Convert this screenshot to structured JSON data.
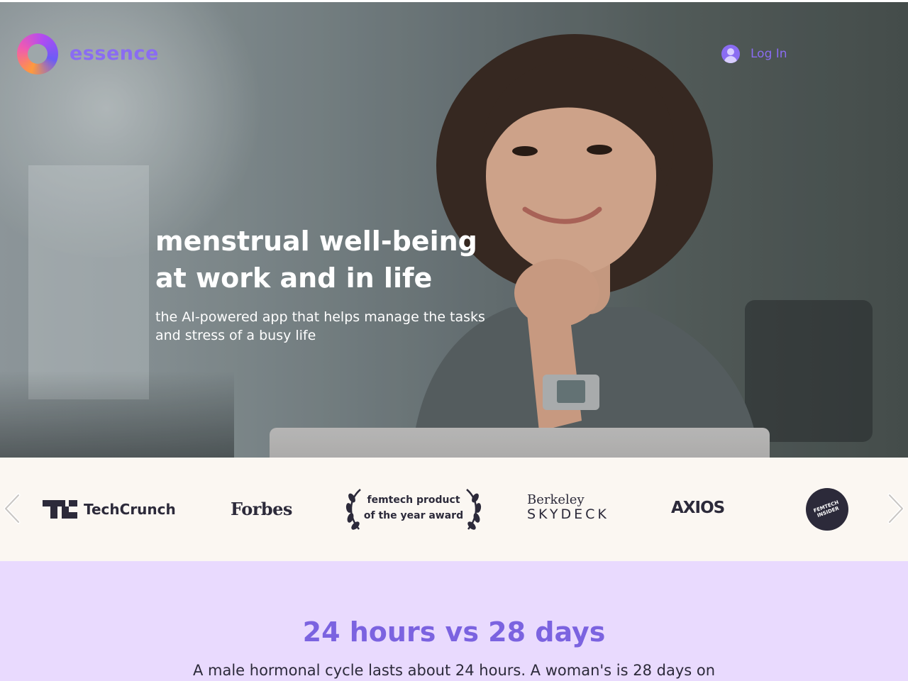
{
  "header": {
    "logo_text": "essence",
    "login_label": "Log In"
  },
  "hero": {
    "headline_line1": "menstrual well-being",
    "headline_line2": "at work and in life",
    "sub_line1": "the AI-powered app that helps manage the tasks",
    "sub_line2": "and stress of a busy life"
  },
  "press": {
    "logos": [
      "TechCrunch",
      "Forbes",
      "femtech product",
      "of the year award",
      "Berkeley",
      "SKYDECK",
      "AXIOS",
      "FEMTECH INSIDER"
    ]
  },
  "section": {
    "title": "24 hours vs 28 days",
    "text": "A male hormonal cycle lasts about 24 hours. A woman's is 28 days on"
  },
  "colors": {
    "accent": "#8a6cf2",
    "section_bg": "#e9dafe",
    "press_bg": "#fbf7f2",
    "logo_dark": "#2c2a3a"
  }
}
